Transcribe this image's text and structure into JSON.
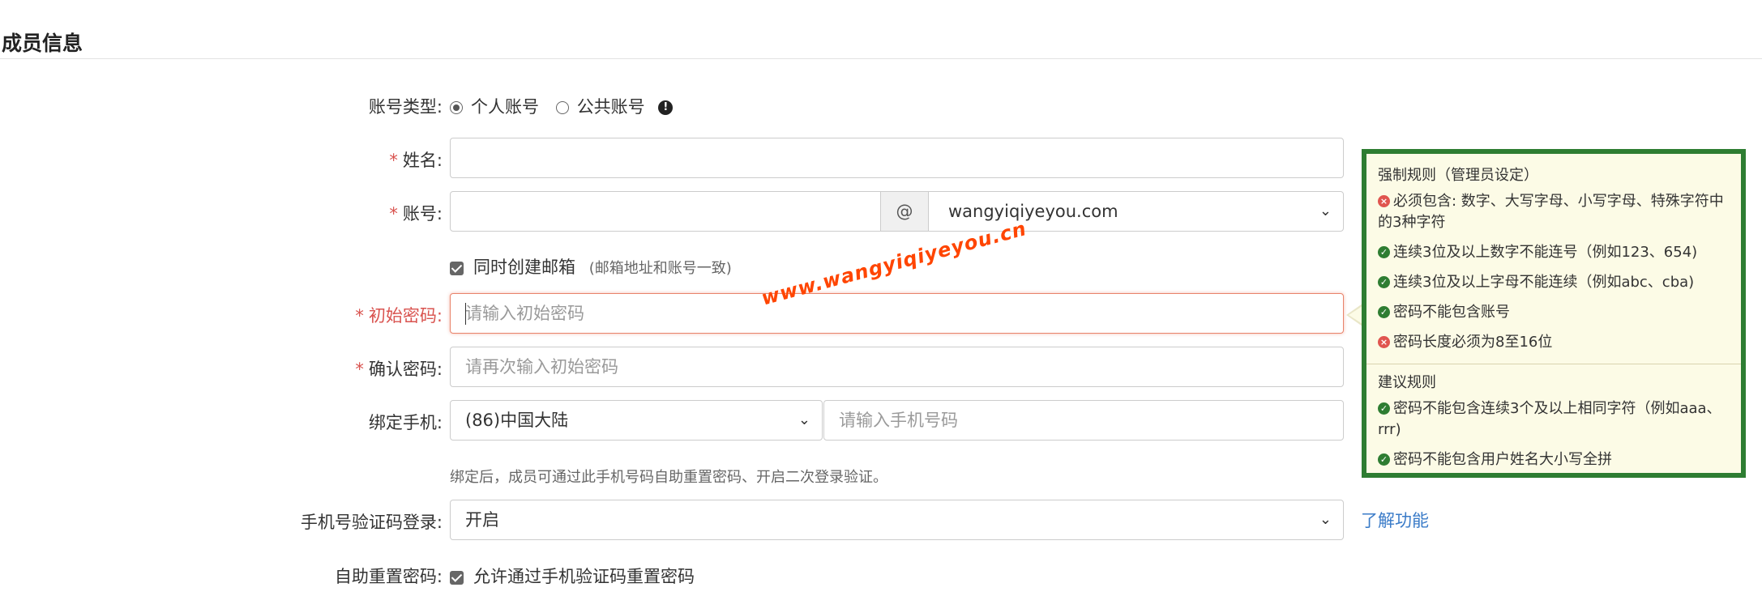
{
  "page": {
    "title": "成员信息"
  },
  "form": {
    "account_type": {
      "label": "账号类型:",
      "options": [
        {
          "label": "个人账号",
          "selected": true
        },
        {
          "label": "公共账号",
          "selected": false
        }
      ],
      "info_icon": "info-icon"
    },
    "name": {
      "label": "姓名:",
      "required_mark": "*",
      "value": ""
    },
    "account": {
      "label": "账号:",
      "required_mark": "*",
      "value": "",
      "at": "@",
      "domain": "wangyiqiyeyou.com"
    },
    "create_mailbox": {
      "label": "同时创建邮箱",
      "hint": "(邮箱地址和账号一致)",
      "checked": true
    },
    "initial_password": {
      "label": "初始密码:",
      "required_mark": "*",
      "placeholder": "请输入初始密码"
    },
    "confirm_password": {
      "label": "确认密码:",
      "required_mark": "*",
      "placeholder": "请再次输入初始密码"
    },
    "bind_phone": {
      "label": "绑定手机:",
      "country": "(86)中国大陆",
      "placeholder": "请输入手机号码",
      "hint": "绑定后，成员可通过此手机号码自助重置密码、开启二次登录验证。"
    },
    "sms_login": {
      "label": "手机号验证码登录:",
      "value": "开启",
      "link": "了解功能"
    },
    "self_reset": {
      "label": "自助重置密码:",
      "option": "允许通过手机验证码重置密码",
      "checked": true
    }
  },
  "rules_panel": {
    "mandatory_title": "强制规则（管理员设定）",
    "mandatory": [
      {
        "status": "fail",
        "text": "必须包含: 数字、大写字母、小写字母、特殊字符中的3种字符"
      },
      {
        "status": "ok",
        "text": "连续3位及以上数字不能连号（例如123、654)"
      },
      {
        "status": "ok",
        "text": "连续3位及以上字母不能连续（例如abc、cba)"
      },
      {
        "status": "ok",
        "text": "密码不能包含账号"
      },
      {
        "status": "fail",
        "text": "密码长度必须为8至16位"
      }
    ],
    "suggested_title": "建议规则",
    "suggested": [
      {
        "status": "ok",
        "text": "密码不能包含连续3个及以上相同字符（例如aaa、rrr)"
      },
      {
        "status": "ok",
        "text": "密码不能包含用户姓名大小写全拼"
      }
    ],
    "colors": {
      "border": "#2e7d32",
      "ok": "#2e7d32",
      "fail": "#e0554f",
      "background": "#fcfbe6"
    }
  },
  "watermark": "www.wangyiqiyeyou.cn",
  "colors": {
    "required": "#d9534f",
    "link": "#3a7bc8",
    "error_border": "#e8836b"
  }
}
